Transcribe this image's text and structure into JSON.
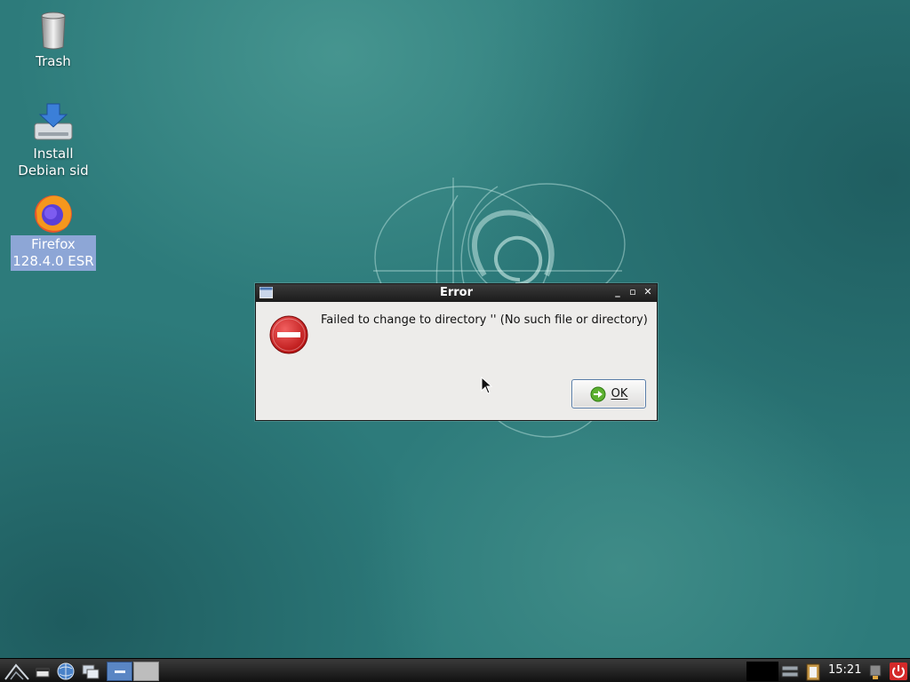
{
  "desktop": {
    "icons": [
      {
        "label": "Trash",
        "icon": "trash-icon"
      },
      {
        "label_line1": "Install",
        "label_line2": "Debian sid",
        "icon": "install-drive-icon"
      },
      {
        "label_line1": "Firefox",
        "label_line2": "128.4.0 ESR",
        "icon": "firefox-icon",
        "selected": true
      }
    ]
  },
  "dialog": {
    "title": "Error",
    "message": "Failed to change to directory '' (No such file or directory)",
    "ok_label": "OK",
    "icon": "error-icon"
  },
  "taskbar": {
    "clock": "15:21",
    "items": [
      "menu-icon",
      "show-desktop-icon",
      "browser-icon",
      "windows-icon",
      "task-button-active",
      "task-button"
    ],
    "tray": [
      "network-icon",
      "clipboard-icon",
      "usb-icon",
      "power-icon"
    ]
  },
  "colors": {
    "desktop_bg": "#2d7b7b",
    "selection": "#8da6d6",
    "titlebar": "#2a2a2a",
    "dialog_bg": "#edecea",
    "error_red": "#d01c1c"
  }
}
